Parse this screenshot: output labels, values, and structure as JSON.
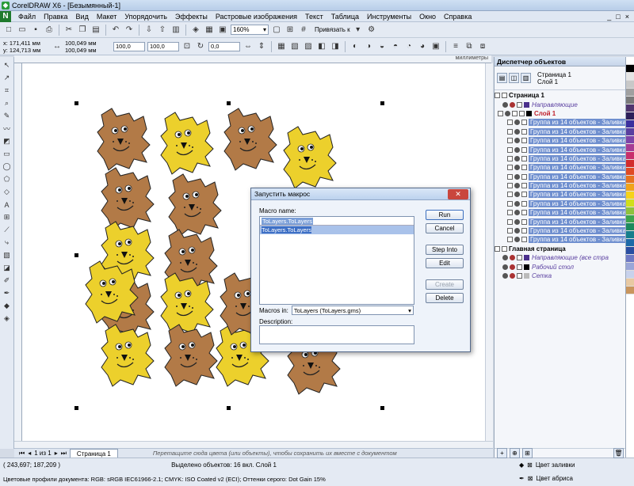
{
  "window": {
    "title": "CorelDRAW X6 - [Безымянный-1]",
    "controls": [
      "_",
      "□",
      "×"
    ]
  },
  "menu": [
    "Файл",
    "Правка",
    "Вид",
    "Макет",
    "Упорядочить",
    "Эффекты",
    "Растровые изображения",
    "Текст",
    "Таблица",
    "Инструменты",
    "Окно",
    "Справка"
  ],
  "toolbar": {
    "zoom": "160%",
    "snap": "Привязать к"
  },
  "properties": {
    "x": "x: 171,411 мм",
    "y": "y: 124,713 мм",
    "w": "100,049 мм",
    "h": "100,049 мм",
    "scale1": "100,0",
    "scale2": "100,0",
    "angle": "0,0"
  },
  "ruler": {
    "unit": "миллиметры"
  },
  "dialog": {
    "title": "Запустить макрос",
    "macro_name_label": "Macro name:",
    "macro_name_value": "ToLayers.ToLayers",
    "list_items": [
      "ToLayers.ToLayers"
    ],
    "macros_in_label": "Macros in:",
    "macros_in_value": "ToLayers (ToLayers.gms)",
    "description_label": "Description:",
    "buttons": {
      "run": "Run",
      "cancel": "Cancel",
      "step_into": "Step Into",
      "edit": "Edit",
      "create": "Create",
      "delete": "Delete"
    }
  },
  "docker": {
    "title": "Диспетчер объектов",
    "current_page": "Страница 1",
    "current_layer": "Слой 1",
    "page1": "Страница 1",
    "guides": "Направляющие",
    "layer1": "Слой 1",
    "group_item": "Группа из 14 объектов - Заливка",
    "group_count": 14,
    "master_page": "Главная страница",
    "master_guides": "Направляющие (все стра",
    "desktop": "Рабочий стол",
    "grid": "Сетка"
  },
  "pagebar": {
    "page_count": "1 из 1",
    "tab": "Страница 1",
    "hint": "Перетащите сюда цвета (или объекты), чтобы сохранить их вместе с документом"
  },
  "status": {
    "coords": "( 243,697; 187,209 )",
    "selected": "Выделено объектов: 16 вкл. Слой 1",
    "profiles": "Цветовые профили документа: RGB: sRGB IEC61966-2.1; CMYK: ISO Coated v2 (ECI); Оттенки серого: Dot Gain 15%",
    "fill_color": "Цвет заливки",
    "outline_color": "Цвет абриса"
  },
  "colors": {
    "brown": "#b27a47",
    "yellow": "#ecd02c",
    "selection": "#6f8fcf"
  },
  "palette": [
    "#ffffff",
    "#000000",
    "#e6e6e6",
    "#c8c8c8",
    "#a0a0a0",
    "#7a7a7a",
    "#50356e",
    "#2d1f5a",
    "#3b2f9e",
    "#5a3fa0",
    "#7e43a8",
    "#a63b95",
    "#c82f6c",
    "#d22b2b",
    "#e04a24",
    "#e6731f",
    "#f0a31a",
    "#f5d21b",
    "#d0de1c",
    "#8fc23d",
    "#3da44d",
    "#1b8a5e",
    "#167e8c",
    "#1d6aa8",
    "#2a4ea1",
    "#6e79c4",
    "#9aa6d8",
    "#c8d2ec",
    "#e8c9a2",
    "#c9955d"
  ]
}
